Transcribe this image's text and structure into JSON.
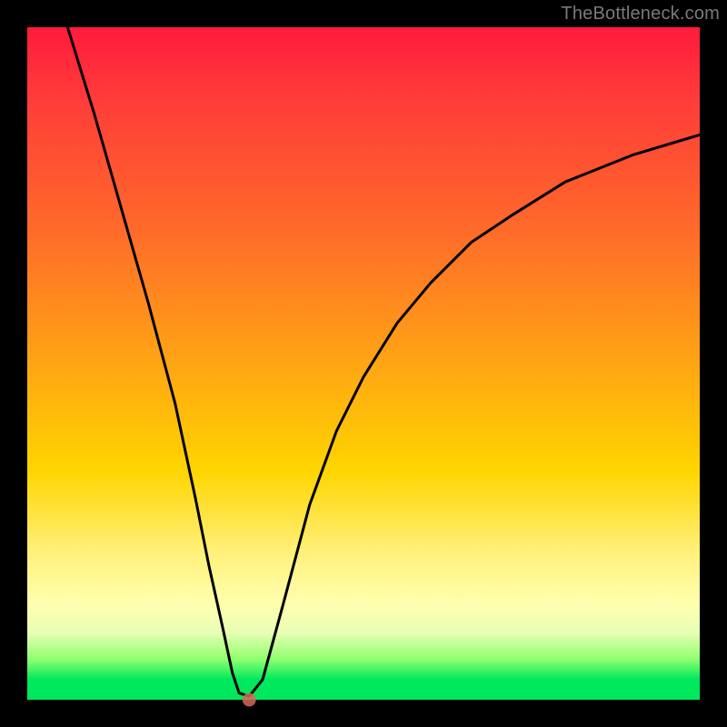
{
  "watermark": "TheBottleneck.com",
  "chart_data": {
    "type": "line",
    "title": "",
    "xlabel": "",
    "ylabel": "",
    "xlim": [
      0,
      100
    ],
    "ylim": [
      0,
      100
    ],
    "series": [
      {
        "name": "curve",
        "x": [
          6,
          10,
          14,
          18,
          22,
          25,
          27,
          29,
          30.5,
          31.5,
          33,
          35,
          38,
          42,
          46,
          50,
          55,
          60,
          66,
          72,
          80,
          90,
          100
        ],
        "y": [
          100,
          87,
          73,
          59,
          44,
          30,
          20,
          11,
          4,
          1,
          0.5,
          3,
          14,
          29,
          40,
          48,
          56,
          62,
          68,
          72,
          77,
          81,
          84
        ]
      }
    ],
    "plateau": {
      "x_start": 29,
      "x_end": 33,
      "y": 0.6
    },
    "marker": {
      "x": 33,
      "y": 0
    },
    "colors": {
      "curve": "#000000",
      "marker": "#d46a5a",
      "gradient_top": "#ff1a3c",
      "gradient_mid": "#ffd500",
      "gradient_bottom": "#00e85c",
      "frame": "#000000"
    }
  }
}
